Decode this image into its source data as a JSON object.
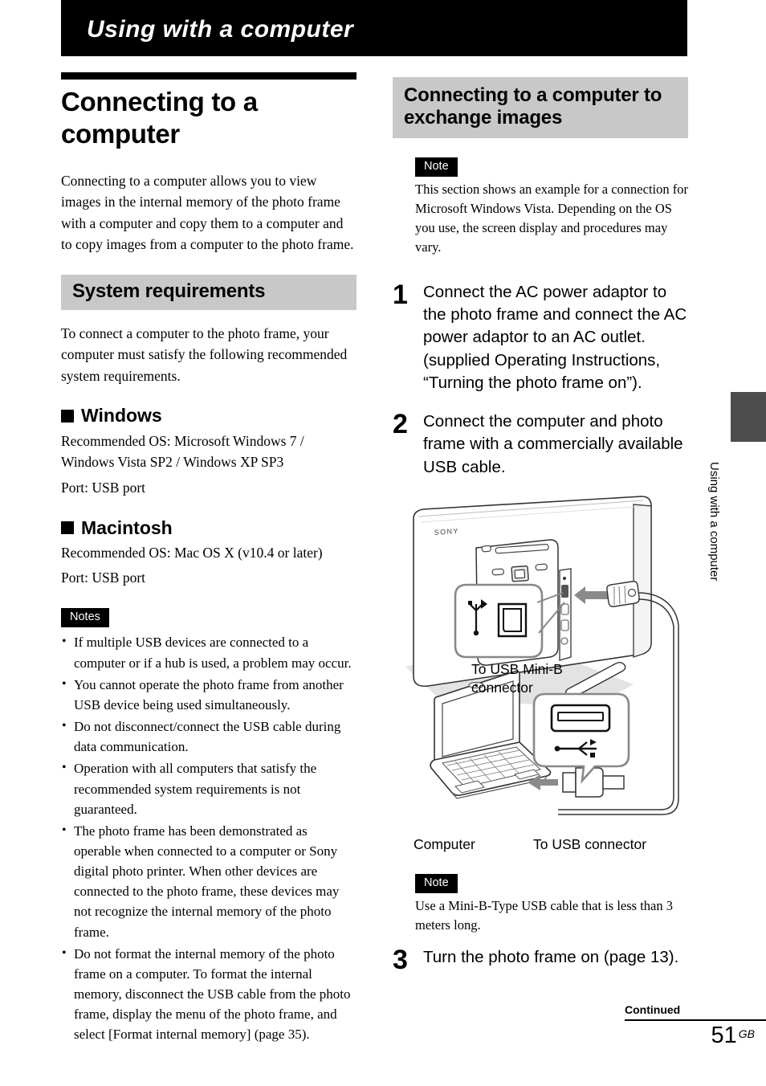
{
  "chapter": {
    "title": "Using with a computer"
  },
  "left": {
    "doc_title": "Connecting to a computer",
    "intro": "Connecting to a computer allows you to view images in the internal memory of the photo frame with a computer and copy them to a computer and to copy images from a computer to the photo frame.",
    "system_requirements_heading": "System requirements",
    "system_requirements_body": "To connect a computer to the photo frame, your computer must satisfy the following recommended system requirements.",
    "windows_heading": "Windows",
    "windows_os": "Recommended OS: Microsoft Windows 7 / Windows Vista SP2 / Windows XP SP3",
    "windows_port": "Port: USB port",
    "macintosh_heading": "Macintosh",
    "macintosh_os": "Recommended OS: Mac OS X (v10.4 or later)",
    "macintosh_port": "Port: USB port",
    "notes_badge": "Notes",
    "notes": [
      "If multiple USB devices are connected to a computer or if a hub is used, a problem may occur.",
      "You cannot operate the photo frame from another USB device being used simultaneously.",
      "Do not disconnect/connect the USB cable during data communication.",
      "Operation with all computers that satisfy the recommended system requirements is not guaranteed.",
      "The photo frame has been demonstrated as operable when connected to a computer or Sony digital photo printer. When other devices are connected to the photo frame, these devices may not recognize the internal memory of the photo frame.",
      "Do not format the internal memory of the photo frame on a computer. To format the internal memory, disconnect the USB cable from the photo frame, display the menu of the photo frame, and select [Format internal memory] (page 35)."
    ]
  },
  "right": {
    "section_heading": "Connecting to a computer to exchange images",
    "note_badge_top": "Note",
    "note_top": "This section shows an example for a connection for Microsoft Windows Vista. Depending on the OS you use, the screen display and procedures may vary.",
    "steps": [
      {
        "number": "1",
        "text": "Connect the AC power adaptor to the photo frame and connect the AC power adaptor to an AC outlet. (supplied Operating Instructions, “Turning the photo frame on”)."
      },
      {
        "number": "2",
        "text": "Connect the computer and photo frame with a commercially available USB cable."
      },
      {
        "number": "3",
        "text": "Turn the photo frame on (page 13)."
      }
    ],
    "figure": {
      "brand": "SONY",
      "label_mini_b": "To USB Mini-B connector",
      "label_computer": "Computer",
      "label_usb": "To USB connector"
    },
    "note_badge_bottom": "Note",
    "note_bottom": "Use a Mini-B-Type USB cable that is less than 3 meters long."
  },
  "side_tab": {
    "text": "Using with a computer",
    "color": "#4d4d4d"
  },
  "footer": {
    "continued": "Continued",
    "page_number": "51",
    "region": "GB"
  },
  "colors": {
    "band_gray": "#c8c8c8",
    "black": "#000000",
    "tab_gray": "#4d4d4d"
  }
}
